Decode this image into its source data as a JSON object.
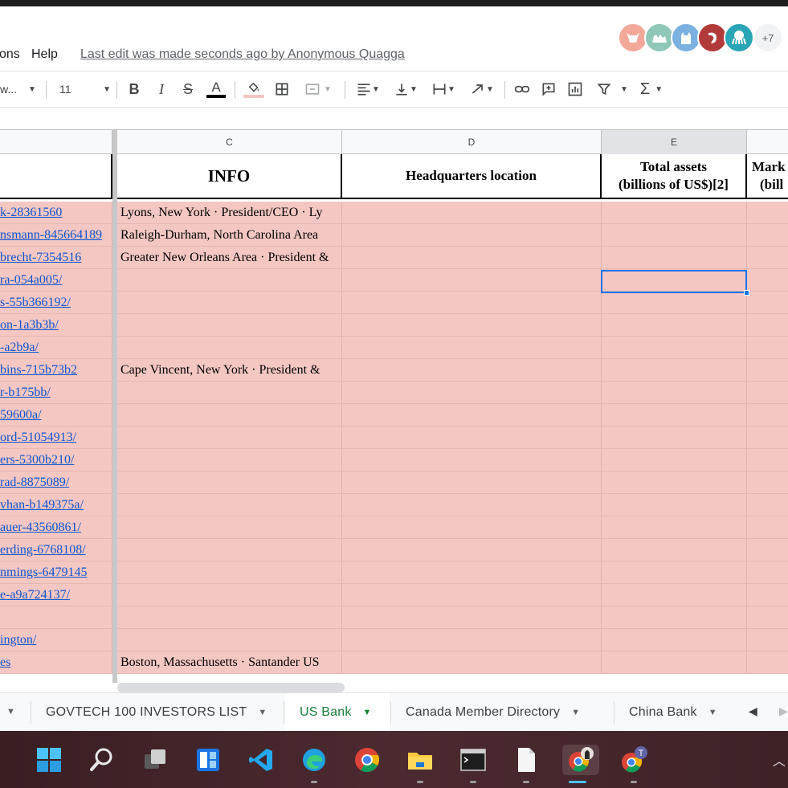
{
  "menu": {
    "items": [
      {
        "label": "ons"
      },
      {
        "label": "Help"
      }
    ],
    "last_edit": "Last edit was made seconds ago by Anonymous Quagga",
    "avatars": [
      {
        "icon": "bull-icon",
        "color": "#f4a89a"
      },
      {
        "icon": "camel-icon",
        "color": "#8fc7b8"
      },
      {
        "icon": "cat-icon",
        "color": "#7ab1e0"
      },
      {
        "icon": "shrimp-icon",
        "color": "#b33a3a"
      },
      {
        "icon": "octopus-icon",
        "color": "#2aa5b5"
      }
    ],
    "avatar_more": "+7"
  },
  "toolbar": {
    "font_name": "w...",
    "font_size": "11"
  },
  "columns": {
    "c": "C",
    "d": "D",
    "e": "E"
  },
  "headers": {
    "info": "INFO",
    "hq": "Headquarters location",
    "total_assets_l1": "Total assets",
    "total_assets_l2": "(billions of US$)[2]",
    "market_l1": "Mark",
    "market_l2": "(bill"
  },
  "rows": [
    {
      "link": "k-28361560",
      "info": "Lyons, New York · President/CEO · Ly"
    },
    {
      "link": "nsmann-845664189",
      "info": "Raleigh-Durham, North Carolina Area"
    },
    {
      "link": "brecht-7354516",
      "info": "Greater New Orleans Area · President &"
    },
    {
      "link": "ra-054a005/",
      "info": ""
    },
    {
      "link": "s-55b366192/",
      "info": ""
    },
    {
      "link": "on-1a3b3b/",
      "info": ""
    },
    {
      "link": "-a2b9a/",
      "info": ""
    },
    {
      "link": "bins-715b73b2",
      "info": "Cape Vincent, New York · President &"
    },
    {
      "link": "r-b175bb/",
      "info": ""
    },
    {
      "link": "59600a/",
      "info": ""
    },
    {
      "link": "ord-51054913/",
      "info": ""
    },
    {
      "link": "ers-5300b210/",
      "info": ""
    },
    {
      "link": "rad-8875089/",
      "info": ""
    },
    {
      "link": "vhan-b149375a/",
      "info": ""
    },
    {
      "link": "auer-43560861/",
      "info": ""
    },
    {
      "link": "erding-6768108/",
      "info": ""
    },
    {
      "link": "nmings-6479145",
      "info": ""
    },
    {
      "link": "e-a9a724137/",
      "info": ""
    },
    {
      "link": "",
      "info": ""
    },
    {
      "link": "ington/",
      "info": ""
    },
    {
      "link": "es",
      "info": "Boston, Massachusetts · Santander US"
    }
  ],
  "sheet_tabs": [
    {
      "label": "GOVTECH 100 INVESTORS LIST",
      "active": false
    },
    {
      "label": "US Bank",
      "active": true
    },
    {
      "label": "Canada Member Directory",
      "active": false
    },
    {
      "label": "China Bank",
      "active": false
    }
  ],
  "taskbar": [
    {
      "icon": "windows-start-icon"
    },
    {
      "icon": "search-icon"
    },
    {
      "icon": "task-view-icon"
    },
    {
      "icon": "widgets-icon"
    },
    {
      "icon": "vscode-icon"
    },
    {
      "icon": "edge-icon"
    },
    {
      "icon": "chrome-icon"
    },
    {
      "icon": "file-explorer-icon"
    },
    {
      "icon": "terminal-icon"
    },
    {
      "icon": "notepad-icon"
    },
    {
      "icon": "chrome-profile-icon"
    },
    {
      "icon": "chrome-teams-icon"
    }
  ]
}
